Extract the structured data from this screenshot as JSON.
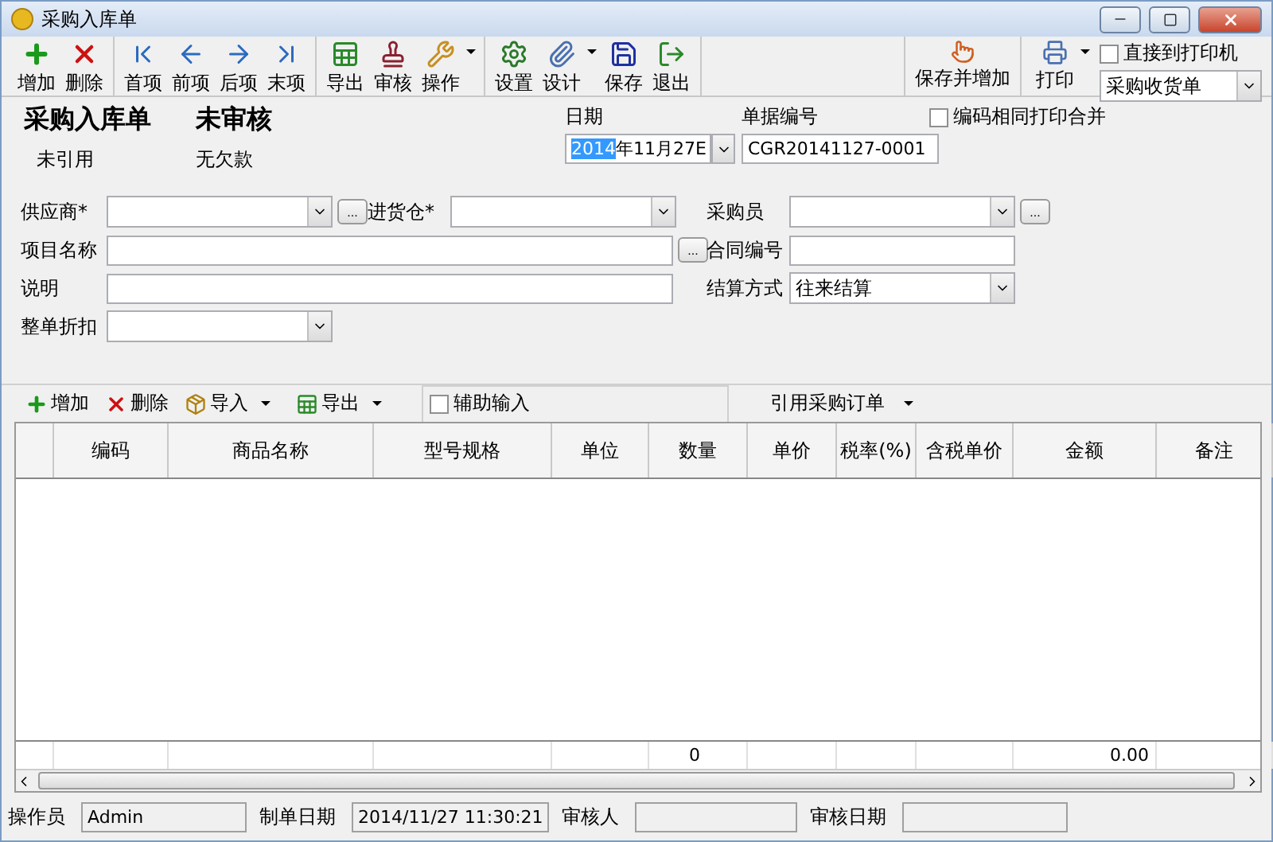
{
  "window": {
    "title": "采购入库单"
  },
  "toolbar": {
    "groups": [
      {
        "buttons": [
          {
            "label": "增加",
            "dropdown": false
          },
          {
            "label": "删除",
            "dropdown": false
          }
        ]
      },
      {
        "buttons": [
          {
            "label": "首项",
            "dropdown": false
          },
          {
            "label": "前项",
            "dropdown": false
          },
          {
            "label": "后项",
            "dropdown": false
          },
          {
            "label": "末项",
            "dropdown": false
          }
        ]
      },
      {
        "buttons": [
          {
            "label": "导出",
            "dropdown": false
          },
          {
            "label": "审核",
            "dropdown": false
          },
          {
            "label": "操作",
            "dropdown": true
          }
        ]
      },
      {
        "buttons": [
          {
            "label": "设置",
            "dropdown": false
          },
          {
            "label": "设计",
            "dropdown": true
          },
          {
            "label": "保存",
            "dropdown": false
          },
          {
            "label": "退出",
            "dropdown": false
          }
        ]
      }
    ],
    "save_and_add": "保存并增加",
    "print": {
      "label": "打印",
      "dropdown": true
    },
    "direct_print": {
      "label": "直接到打印机",
      "checked": false
    },
    "template": {
      "value": "采购收货单"
    }
  },
  "header": {
    "doc_title": "采购入库单",
    "audit_status": "未审核",
    "reference_status": "未引用",
    "debt_status": "无欠款",
    "date": {
      "label": "日期",
      "selected_part": "2014",
      "rest": "年11月27E"
    },
    "doc_number": {
      "label": "单据编号",
      "value": "CGR20141127-0001"
    },
    "merge_print": {
      "label": "编码相同打印合并",
      "checked": false
    }
  },
  "form": {
    "rows": [
      {
        "left": [
          {
            "label": "供应商*",
            "kind": "combo",
            "browse": "..."
          },
          {
            "label": "进货仓*",
            "kind": "combo"
          }
        ],
        "right": [
          {
            "label": "采购员",
            "kind": "combo",
            "browse": "..."
          }
        ]
      },
      {
        "left": [
          {
            "label": "项目名称",
            "kind": "text",
            "browse": "..."
          }
        ],
        "right": [
          {
            "label": "合同编号",
            "kind": "text"
          }
        ]
      },
      {
        "left": [
          {
            "label": "说明",
            "kind": "text"
          }
        ],
        "right": [
          {
            "label": "结算方式",
            "kind": "combo",
            "value": "往来结算"
          }
        ]
      },
      {
        "left": [
          {
            "label": "整单折扣",
            "kind": "combo"
          }
        ],
        "right": []
      }
    ]
  },
  "detail_toolbar": {
    "buttons": [
      {
        "label": "增加",
        "dropdown": false
      },
      {
        "label": "删除",
        "dropdown": false
      },
      {
        "label": "导入",
        "dropdown": true
      },
      {
        "label": "导出",
        "dropdown": true
      }
    ],
    "assist_input": {
      "label": "辅助输入",
      "checked": false
    },
    "reference_order": {
      "label": "引用采购订单",
      "dropdown": true
    }
  },
  "table": {
    "columns": [
      "编码",
      "商品名称",
      "型号规格",
      "单位",
      "数量",
      "单价",
      "税率(%)",
      "含税单价",
      "金额",
      "备注"
    ],
    "total_quantity": "0",
    "total_amount": "0.00"
  },
  "status_bar": [
    {
      "label": "操作员",
      "value": "Admin"
    },
    {
      "label": "制单日期",
      "value": "2014/11/27 11:30:21"
    },
    {
      "label": "审核人"
    },
    {
      "label": "审核日期"
    }
  ]
}
